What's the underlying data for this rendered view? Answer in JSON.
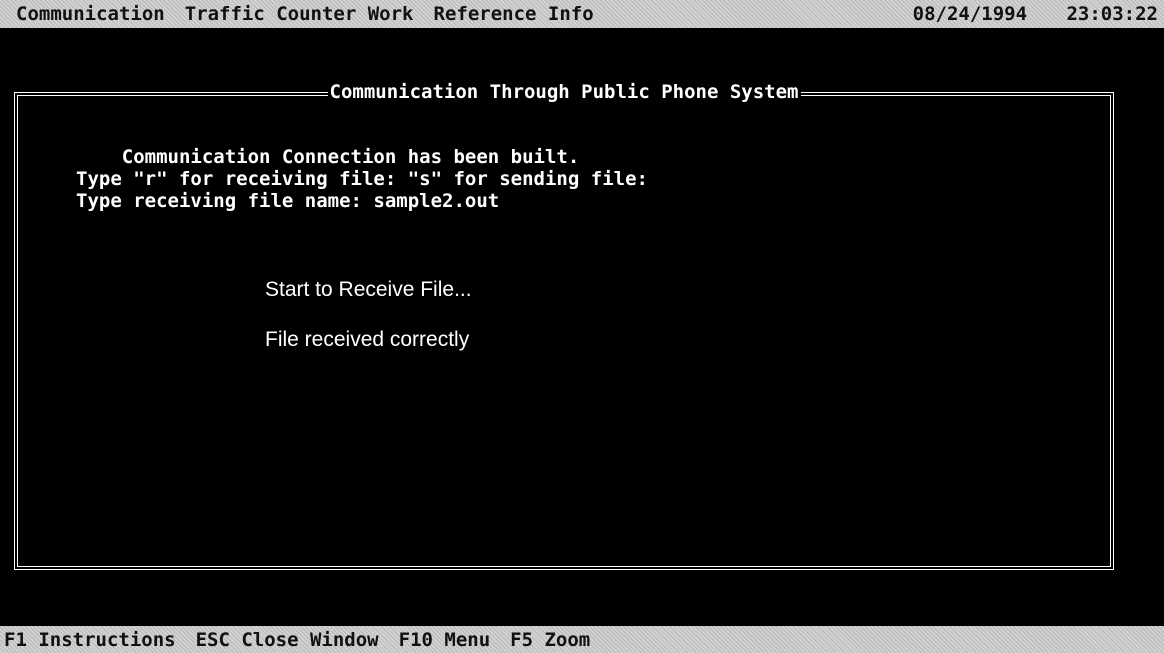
{
  "menu": {
    "items": [
      "Communication",
      "Traffic Counter Work",
      "Reference Info"
    ],
    "date": "08/24/1994",
    "time": "23:03:22"
  },
  "window": {
    "title": "Communication Through Public Phone System",
    "lines": [
      "    Communication Connection has been built.",
      "Type \"r\" for receiving file: \"s\" for sending file:",
      "Type receiving file name: sample2.out"
    ],
    "messages": [
      "Start to Receive File...",
      "File received correctly"
    ]
  },
  "statusbar": {
    "keys": [
      "F1 Instructions",
      "ESC Close Window",
      "F10 Menu",
      "F5 Zoom"
    ]
  }
}
